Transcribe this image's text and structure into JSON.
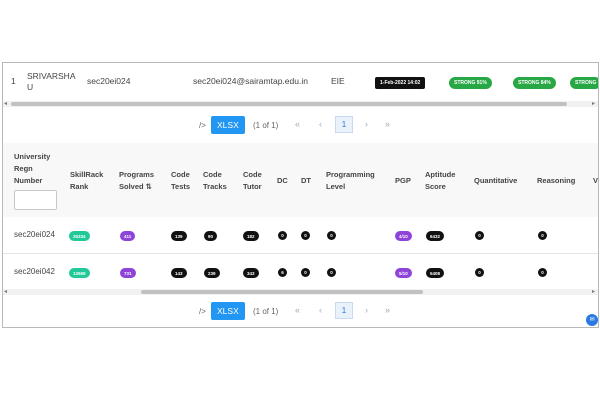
{
  "top_row": {
    "index": "1",
    "name": "SRIVARSHA U",
    "regn": "sec20ei024",
    "email": "sec20ei024@sairamtap.edu.in",
    "dept": "EIE",
    "date": "1-Feb-2022 14:02",
    "strong": [
      "STRONG 91%",
      "STRONG 84%",
      "STRONG"
    ]
  },
  "pager": {
    "export_prefix": "/>",
    "export_label": "XLSX",
    "page_info": "(1 of 1)",
    "first": "«",
    "prev": "‹",
    "current_page": "1",
    "next": "›",
    "last": "»"
  },
  "table": {
    "headers": {
      "regn": [
        "University",
        "Regn",
        "Number"
      ],
      "rank": [
        "SkillRack",
        "Rank"
      ],
      "programs": [
        "Programs",
        "Solved ⇅"
      ],
      "code_tests": [
        "Code",
        "Tests"
      ],
      "code_tracks": [
        "Code",
        "Tracks"
      ],
      "code_tutor": [
        "Code",
        "Tutor"
      ],
      "dc": "DC",
      "dt": "DT",
      "prog_level": [
        "Programming",
        "Level"
      ],
      "pgp": "PGP",
      "aptitude": [
        "Aptitude",
        "Score"
      ],
      "quant": "Quantitative",
      "reasoning": "Reasoning",
      "more": "V"
    },
    "rows": [
      {
        "regn": "sec20ei024",
        "rank": "26334",
        "programs": "411",
        "code_tests": "139",
        "code_tracks": "90",
        "code_tutor": "182",
        "dc": "0",
        "dt": "0",
        "prog_level": "0",
        "pgp": "4/10",
        "aptitude": "6432",
        "quant": "0",
        "reasoning": "0"
      },
      {
        "regn": "sec20ei042",
        "rank": "12669",
        "programs": "731",
        "code_tests": "143",
        "code_tracks": "239",
        "code_tutor": "343",
        "dc": "6",
        "dt": "0",
        "prog_level": "0",
        "pgp": "5/10",
        "aptitude": "5408",
        "quant": "0",
        "reasoning": "0"
      }
    ]
  },
  "colors": {
    "accent": "#2196f3",
    "strong": "#28a745",
    "teal": "#20c997",
    "purple": "#8e44d8"
  },
  "icons": {
    "chat": "chat-icon"
  }
}
